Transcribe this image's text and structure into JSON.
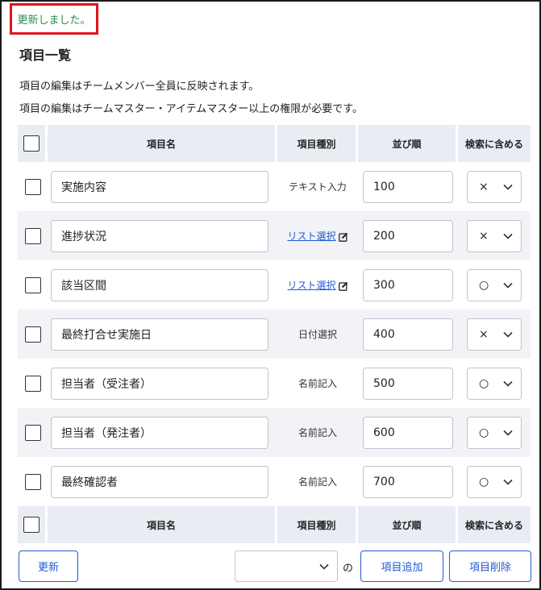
{
  "notice": "更新しました。",
  "title": "項目一覧",
  "descriptions": [
    "項目の編集はチームメンバー全員に反映されます。",
    "項目の編集はチームマスター・アイテムマスター以上の権限が必要です。"
  ],
  "table": {
    "headers": [
      "項目名",
      "項目種別",
      "並び順",
      "検索に含める"
    ],
    "rows": [
      {
        "name": "実施内容",
        "type": "テキスト入力",
        "type_link": false,
        "order": "100",
        "search": "×"
      },
      {
        "name": "進捗状況",
        "type": "リスト選択",
        "type_link": true,
        "order": "200",
        "search": "×"
      },
      {
        "name": "該当区間",
        "type": "リスト選択",
        "type_link": true,
        "order": "300",
        "search": "○"
      },
      {
        "name": "最終打合せ実施日",
        "type": "日付選択",
        "type_link": false,
        "order": "400",
        "search": "×"
      },
      {
        "name": "担当者（受注者）",
        "type": "名前記入",
        "type_link": false,
        "order": "500",
        "search": "○"
      },
      {
        "name": "担当者（発注者）",
        "type": "名前記入",
        "type_link": false,
        "order": "600",
        "search": "○"
      },
      {
        "name": "最終確認者",
        "type": "名前記入",
        "type_link": false,
        "order": "700",
        "search": "○"
      }
    ]
  },
  "buttons": {
    "update": "更新",
    "add": "項目追加",
    "delete": "項目削除"
  },
  "bottom_select_value": "",
  "no_label": "の",
  "colors": {
    "accent": "#1f5bd6",
    "notice_border": "#e0141e",
    "notice_text": "#2e8a4a",
    "header_bg": "#e9ecf3"
  }
}
